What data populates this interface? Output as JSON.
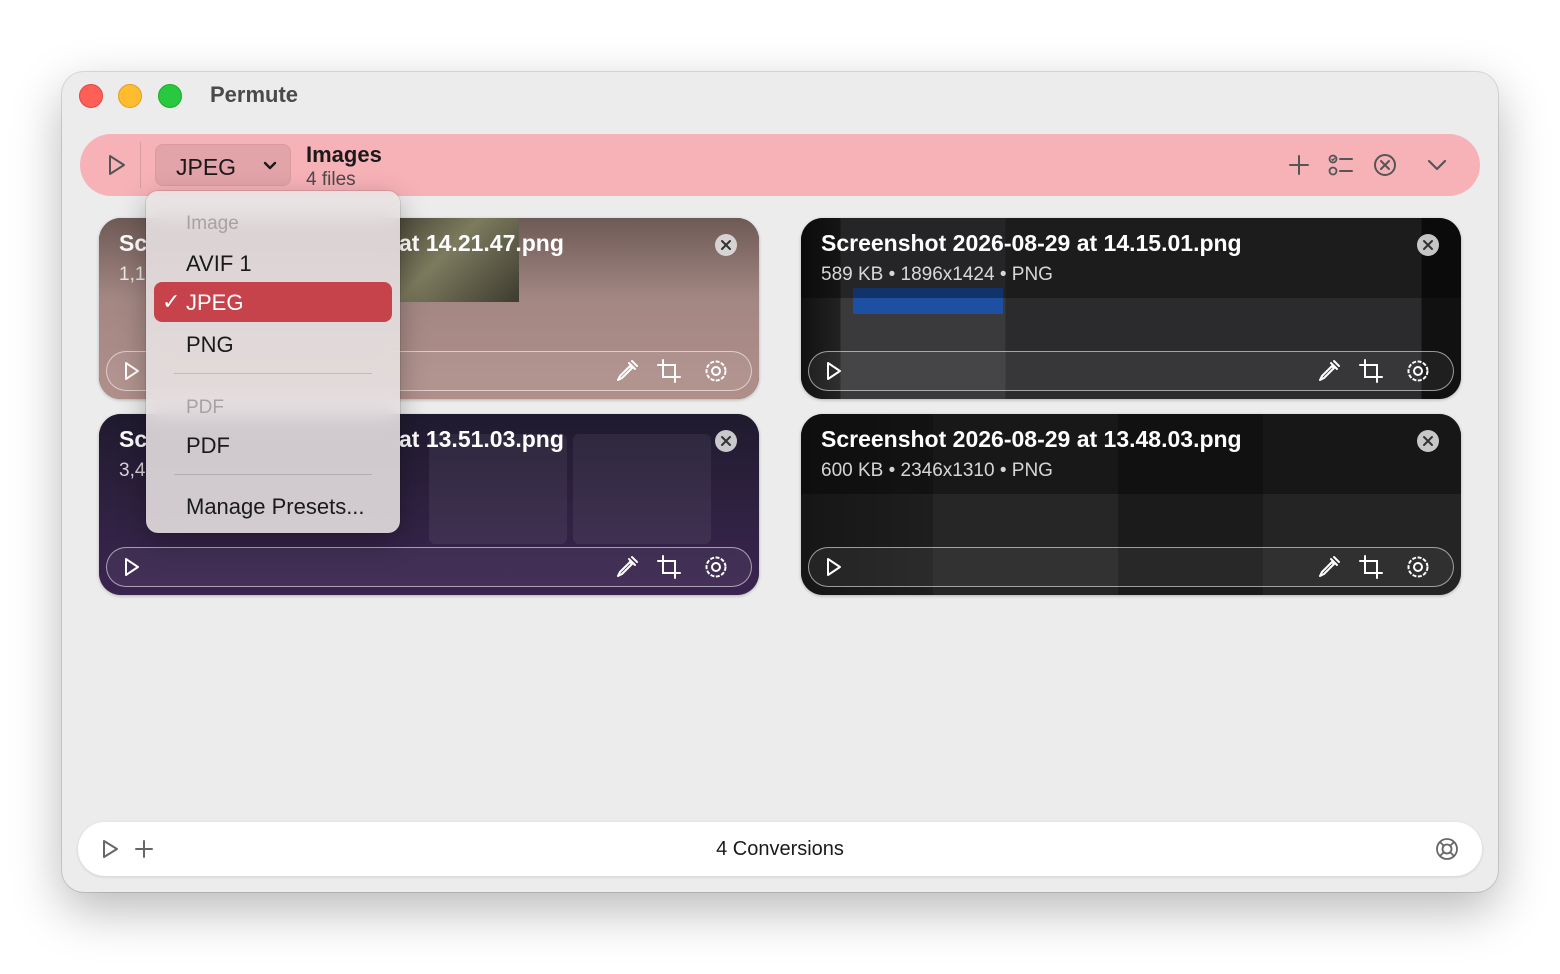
{
  "window": {
    "title": "Permute"
  },
  "header": {
    "format_label": "JPEG",
    "group_title": "Images",
    "group_subtitle": "4 files",
    "bar_color": "#f7b2b8"
  },
  "cards": [
    {
      "title": "Screenshot 2026-08-29 at 14.21.47.png",
      "visible_title": "at 14.21.47.png",
      "title_prefix": "Sc",
      "meta_prefix": "1,1"
    },
    {
      "title": "Screenshot 2026-08-29 at 14.15.01.png",
      "meta": "589 KB • 1896x1424 • PNG"
    },
    {
      "title": "Screenshot 2026-08-29 at 13.51.03.png",
      "visible_title": "at 13.51.03.png",
      "title_prefix": "Sc",
      "meta_prefix": "3,4"
    },
    {
      "title": "Screenshot 2026-08-29 at 13.48.03.png",
      "meta": "600 KB • 2346x1310 • PNG"
    }
  ],
  "format_menu": {
    "section_image": "Image",
    "items_image": [
      "AVIF 1",
      "JPEG",
      "PNG"
    ],
    "selected": "JPEG",
    "section_pdf": "PDF",
    "items_pdf": [
      "PDF"
    ],
    "manage": "Manage Presets...",
    "highlight_color": "#c7434b"
  },
  "footer": {
    "count_label": "4 Conversions"
  },
  "icons": [
    "play-icon",
    "chevron-down-icon",
    "plus-icon",
    "checklist-icon",
    "close-circle-icon",
    "collapse-chevron-icon",
    "eyedropper-icon",
    "crop-icon",
    "settings-gear-icon",
    "help-lifebuoy-icon"
  ]
}
